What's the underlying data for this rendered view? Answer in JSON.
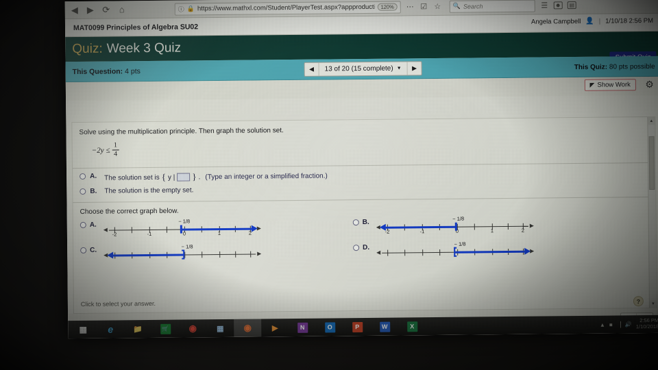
{
  "browser": {
    "back_icon": "back-arrow-icon",
    "forward_icon": "forward-arrow-icon",
    "reload_icon": "reload-icon",
    "home_icon": "home-icon",
    "url": "https://www.mathxl.com/Student/PlayerTest.aspx?appproductid",
    "zoom_level": "120%",
    "search_placeholder": "Search",
    "lock_icon": "lock-icon",
    "info_icon": "site-info-icon",
    "menu_icon": "overflow-menu-icon",
    "pocket_icon": "pocket-icon",
    "bookmark_icon": "star-bookmark-icon",
    "library_icon": "library-icon",
    "account_icon": "account-icon",
    "sidebar_icon": "page-actions-icon"
  },
  "course": {
    "title": "MAT0099 Principles of Algebra SU02"
  },
  "header": {
    "quiz_label": "Quiz:",
    "quiz_name": "Week 3 Quiz",
    "user_name": "Angela Campbell",
    "user_icon": "person-icon",
    "separator": "|",
    "timestamp": "1/10/18 2:56 PM",
    "submit_label": "Submit Quiz",
    "accent_gold": "#d8b45c",
    "header_green": "#0f3d35"
  },
  "question_bar": {
    "this_question_label": "This Question:",
    "this_question_points": "4 pts",
    "prev_icon": "prev-arrow-icon",
    "next_icon": "next-arrow-icon",
    "nav_text": "13 of 20 (15 complete)",
    "nav_caret": "▼",
    "this_quiz_label": "This Quiz:",
    "this_quiz_points": "80 pts possible",
    "teal": "#53b0c0"
  },
  "toolbar": {
    "show_work_label": "Show Work",
    "show_work_icon": "show-work-icon",
    "settings_icon": "gear-icon"
  },
  "question": {
    "prompt": "Solve using the multiplication principle. Then graph the solution set.",
    "expression": {
      "lhs": "−2y",
      "relation": "≤",
      "numerator": "1",
      "denominator": "4"
    },
    "choices": [
      {
        "letter": "A.",
        "text_before": "The solution set is",
        "brace_open": "{",
        "var_pipe": "y |",
        "brace_close": "}",
        "period": ".",
        "hint": "(Type an integer or a simplified fraction.)"
      },
      {
        "letter": "B.",
        "text_before": "The solution is the empty set.",
        "brace_open": "",
        "var_pipe": "",
        "brace_close": "",
        "period": "",
        "hint": ""
      }
    ],
    "choose_graph_label": "Choose the correct graph below.",
    "click_hint": "Click to select your answer."
  },
  "graphs": {
    "tick_labels": [
      "-2",
      "-1",
      "0",
      "1",
      "2"
    ],
    "point_label": "− 1/8",
    "line_color": "#1540d8",
    "options": [
      {
        "letter": "A.",
        "direction": "right",
        "endpoint_style": "cap",
        "left_arrow": true,
        "right_arrow": true
      },
      {
        "letter": "B.",
        "direction": "left",
        "endpoint_style": "cap",
        "left_arrow": true,
        "right_arrow": true
      },
      {
        "letter": "C.",
        "direction": "left",
        "endpoint_style": "bracket",
        "left_arrow": true,
        "right_arrow": true
      },
      {
        "letter": "D.",
        "direction": "right",
        "endpoint_style": "bracket",
        "left_arrow": true,
        "right_arrow": true
      }
    ]
  },
  "footer": {
    "help_label": "?",
    "prev_icon": "prev-page-icon",
    "next_icon": "next-page-icon",
    "scroll_up_icon": "scroll-up-icon",
    "scroll_down_icon": "scroll-down-icon"
  },
  "taskbar": {
    "items": [
      {
        "name": "start-button",
        "glyph": "⊞",
        "bg": "#1a1a1a",
        "fg": "#ffffff",
        "active": false
      },
      {
        "name": "edge-button",
        "glyph": "e",
        "bg": "#1a1a1a",
        "fg": "#4ab3e8",
        "active": false
      },
      {
        "name": "file-explorer-button",
        "glyph": "▤",
        "bg": "#1a1a1a",
        "fg": "#e8c96a",
        "active": false
      },
      {
        "name": "store-button",
        "glyph": "■",
        "bg": "#1e8a3c",
        "fg": "#ffffff",
        "active": false
      },
      {
        "name": "chrome-button",
        "glyph": "◉",
        "bg": "#1a1a1a",
        "fg": "#e84a3c",
        "active": false
      },
      {
        "name": "calculator-button",
        "glyph": "▤",
        "bg": "#1a1a1a",
        "fg": "#9fc5e8",
        "active": false
      },
      {
        "name": "firefox-button",
        "glyph": "◉",
        "bg": "#1a1a1a",
        "fg": "#e8743c",
        "active": true
      },
      {
        "name": "media-player-button",
        "glyph": "▶",
        "bg": "#1a1a1a",
        "fg": "#e8943c",
        "active": false
      },
      {
        "name": "onenote-button",
        "glyph": "N",
        "bg": "#7a3e9d",
        "fg": "#ffffff",
        "active": false
      },
      {
        "name": "outlook-button",
        "glyph": "O",
        "bg": "#1a6fbd",
        "fg": "#ffffff",
        "active": false
      },
      {
        "name": "powerpoint-button",
        "glyph": "P",
        "bg": "#c5452a",
        "fg": "#ffffff",
        "active": false
      },
      {
        "name": "word-button",
        "glyph": "W",
        "bg": "#2a5fbd",
        "fg": "#ffffff",
        "active": false
      },
      {
        "name": "excel-button",
        "glyph": "X",
        "bg": "#1e7a45",
        "fg": "#ffffff",
        "active": false
      }
    ],
    "tray": {
      "show_hidden_icon": "show-hidden-icons",
      "network_icon": "network-icon",
      "volume_icon": "volume-icon",
      "battery_icon": "battery-icon",
      "time": "2:56 PM",
      "date": "1/10/2018"
    }
  }
}
